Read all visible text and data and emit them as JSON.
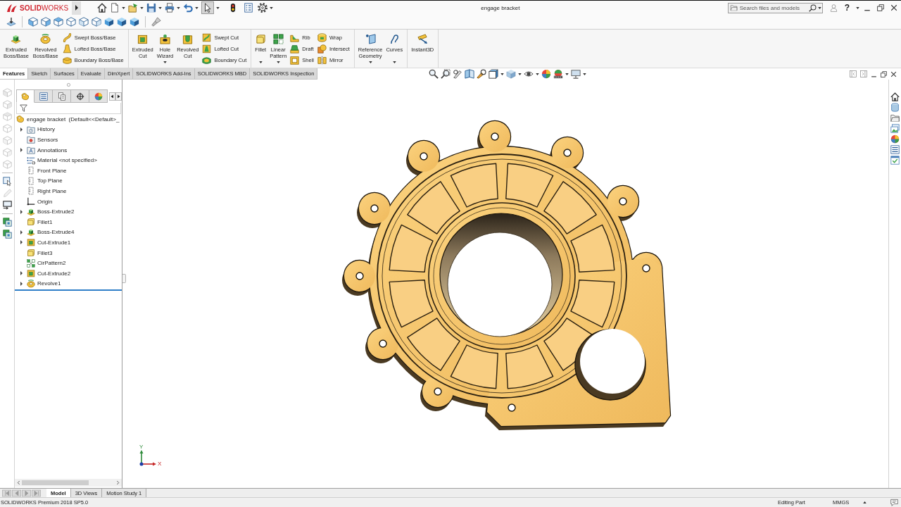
{
  "title_bar": {
    "logo": "**SOLID**WORKS",
    "select_tool": {
      "pressed": true
    },
    "document_title": "engage bracket",
    "search": {
      "placeholder": "Search files and models"
    },
    "help": "?"
  },
  "ribbon": {
    "groups": [
      {
        "large": [
          {
            "lines": [
              "Extruded",
              "Boss/Base"
            ],
            "menu": false
          },
          {
            "lines": [
              "Revolved",
              "Boss/Base"
            ],
            "menu": false
          }
        ],
        "columns": [
          [
            "Swept Boss/Base",
            "Lofted Boss/Base",
            "Boundary Boss/Base"
          ]
        ]
      },
      {
        "large": [
          {
            "lines": [
              "Extruded",
              "Cut"
            ],
            "menu": false
          },
          {
            "lines": [
              "Hole",
              "Wizard"
            ],
            "menu": true
          },
          {
            "lines": [
              "Revolved",
              "Cut"
            ],
            "menu": false
          }
        ],
        "columns": [
          [
            "Swept Cut",
            "Lofted Cut",
            "Boundary Cut"
          ]
        ]
      },
      {
        "large": [
          {
            "lines": [
              "Fillet"
            ],
            "menu": true
          },
          {
            "lines": [
              "Linear",
              "Pattern"
            ],
            "menu": true
          }
        ],
        "columns": [
          [
            "Rib",
            "Draft",
            "Shell"
          ],
          [
            "Wrap",
            "Intersect",
            "Mirror"
          ]
        ]
      },
      {
        "large": [
          {
            "lines": [
              "Reference",
              "Geometry"
            ],
            "menu": true
          },
          {
            "lines": [
              "Curves"
            ],
            "menu": true
          }
        ]
      },
      {
        "large": [
          {
            "lines": [
              "Instant3D"
            ],
            "menu": false
          }
        ]
      }
    ]
  },
  "command_tabs": [
    {
      "label": "Features",
      "selected": true
    },
    {
      "label": "Sketch",
      "selected": false
    },
    {
      "label": "Surfaces",
      "selected": false
    },
    {
      "label": "Evaluate",
      "selected": false
    },
    {
      "label": "DimXpert",
      "selected": false
    },
    {
      "label": "SOLIDWORKS Add-Ins",
      "selected": false
    },
    {
      "label": "SOLIDWORKS MBD",
      "selected": false
    },
    {
      "label": "SOLIDWORKS Inspection",
      "selected": false
    }
  ],
  "side_toolbar": [
    {
      "disabled": true
    },
    {
      "disabled": true
    },
    {
      "disabled": true
    },
    {
      "disabled": true
    },
    {
      "disabled": true
    },
    {
      "disabled": true
    },
    {
      "disabled": true
    },
    {
      "disabled": false
    },
    {
      "disabled": true
    },
    {
      "disabled": false
    },
    {
      "disabled": false
    },
    {
      "disabled": false
    }
  ],
  "feature_manager": {
    "tabs": [
      {
        "selected": true
      },
      {
        "selected": false
      },
      {
        "selected": false
      },
      {
        "selected": false
      },
      {
        "selected": false
      }
    ],
    "root": "engage bracket  (Default<<Default>_",
    "items": [
      {
        "label": "History",
        "kind": "history",
        "expandable": true
      },
      {
        "label": "Sensors",
        "kind": "sensors",
        "expandable": false
      },
      {
        "label": "Annotations",
        "kind": "annotations",
        "expandable": true
      },
      {
        "label": "Material <not specified>",
        "kind": "material",
        "expandable": false
      },
      {
        "label": "Front Plane",
        "kind": "plane",
        "expandable": false
      },
      {
        "label": "Top Plane",
        "kind": "plane",
        "expandable": false
      },
      {
        "label": "Right Plane",
        "kind": "plane",
        "expandable": false
      },
      {
        "label": "Origin",
        "kind": "origin",
        "expandable": false
      },
      {
        "label": "Boss-Extrude2",
        "kind": "extrude",
        "expandable": true
      },
      {
        "label": "Fillet1",
        "kind": "fillet",
        "expandable": false
      },
      {
        "label": "Boss-Extrude4",
        "kind": "extrude",
        "expandable": true
      },
      {
        "label": "Cut-Extrude1",
        "kind": "cut",
        "expandable": true
      },
      {
        "label": "Fillet3",
        "kind": "fillet",
        "expandable": false
      },
      {
        "label": "CirPattern2",
        "kind": "pattern",
        "expandable": false
      },
      {
        "label": "Cut-Extrude2",
        "kind": "cut",
        "expandable": true
      },
      {
        "label": "Revolve1",
        "kind": "revolve",
        "expandable": true
      }
    ]
  },
  "graphics": {
    "triad": {
      "y_label": "Y",
      "x_label": "X"
    }
  },
  "bottom_tabs": [
    {
      "label": "Model",
      "selected": true
    },
    {
      "label": "3D Views",
      "selected": false
    },
    {
      "label": "Motion Study 1",
      "selected": false
    }
  ],
  "status_bar": {
    "product": "SOLIDWORKS Premium 2018 SP5.0",
    "mode": "Editing Part",
    "units": "MMGS"
  }
}
